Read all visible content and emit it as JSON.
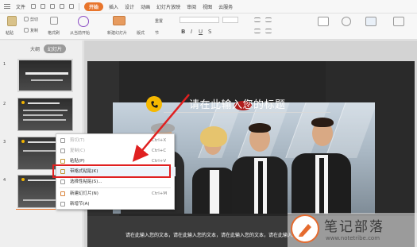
{
  "menubar": {
    "file": "文件",
    "tabs": [
      "开始",
      "插入",
      "设计",
      "动画",
      "幻灯片放映",
      "审阅",
      "视图",
      "云服务"
    ],
    "active_tab": "开始"
  },
  "ribbon": {
    "paste": "粘贴",
    "cut": "剪切",
    "copy": "复制",
    "format_painter": "格式刷",
    "from_current": "从当前开始",
    "new_slide": "新建幻灯片",
    "layout": "版式",
    "section": "节",
    "reset": "重置"
  },
  "left_panel": {
    "tabs": [
      "大纲",
      "幻灯片"
    ],
    "active_tab": "幻灯片",
    "slide_numbers": [
      "1",
      "2",
      "3",
      "4"
    ]
  },
  "slide": {
    "title": "请在此输入您的标题",
    "caption": "请在此输入您的文本，请在此输入您的文本，请在此输入您的文本，请在此输入您的文本。"
  },
  "context_menu": {
    "items": [
      {
        "label": "剪切(T)",
        "shortcut": "Ctrl+X",
        "disabled": true
      },
      {
        "label": "复制(C)",
        "shortcut": "Ctrl+C",
        "disabled": true
      },
      {
        "label": "粘贴(P)",
        "shortcut": "Ctrl+V",
        "disabled": false
      },
      {
        "label": "带格式粘贴(K)",
        "shortcut": "",
        "disabled": false
      },
      {
        "label": "选择性粘贴(S)...",
        "shortcut": "",
        "disabled": false
      },
      {
        "label": "新建幻灯片(N)",
        "shortcut": "Ctrl+M",
        "disabled": false
      },
      {
        "label": "新增节(A)",
        "shortcut": "",
        "disabled": false
      }
    ]
  },
  "watermark": {
    "name": "笔记部落",
    "url": "www.notetribe.com"
  },
  "colors": {
    "accent": "#e8752c",
    "highlight_box": "#e02020",
    "phone_icon": "#f5b800"
  }
}
